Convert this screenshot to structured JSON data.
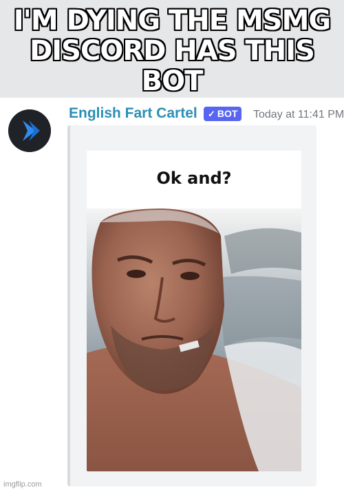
{
  "meme": {
    "caption": "I'M DYING THE MSMG DISCORD HAS THIS BOT",
    "watermark": "imgflip.com"
  },
  "message": {
    "username": "English Fart Cartel",
    "bot_tag": "BOT",
    "timestamp": "Today at 11:41 PM",
    "avatar_icon": "chevron-right-icon",
    "accent_color": "#5865f2",
    "username_color": "#2a8fb5"
  },
  "embed": {
    "gif_caption": "Ok and?",
    "image_description_icon": "bald-man-selfie-image"
  }
}
